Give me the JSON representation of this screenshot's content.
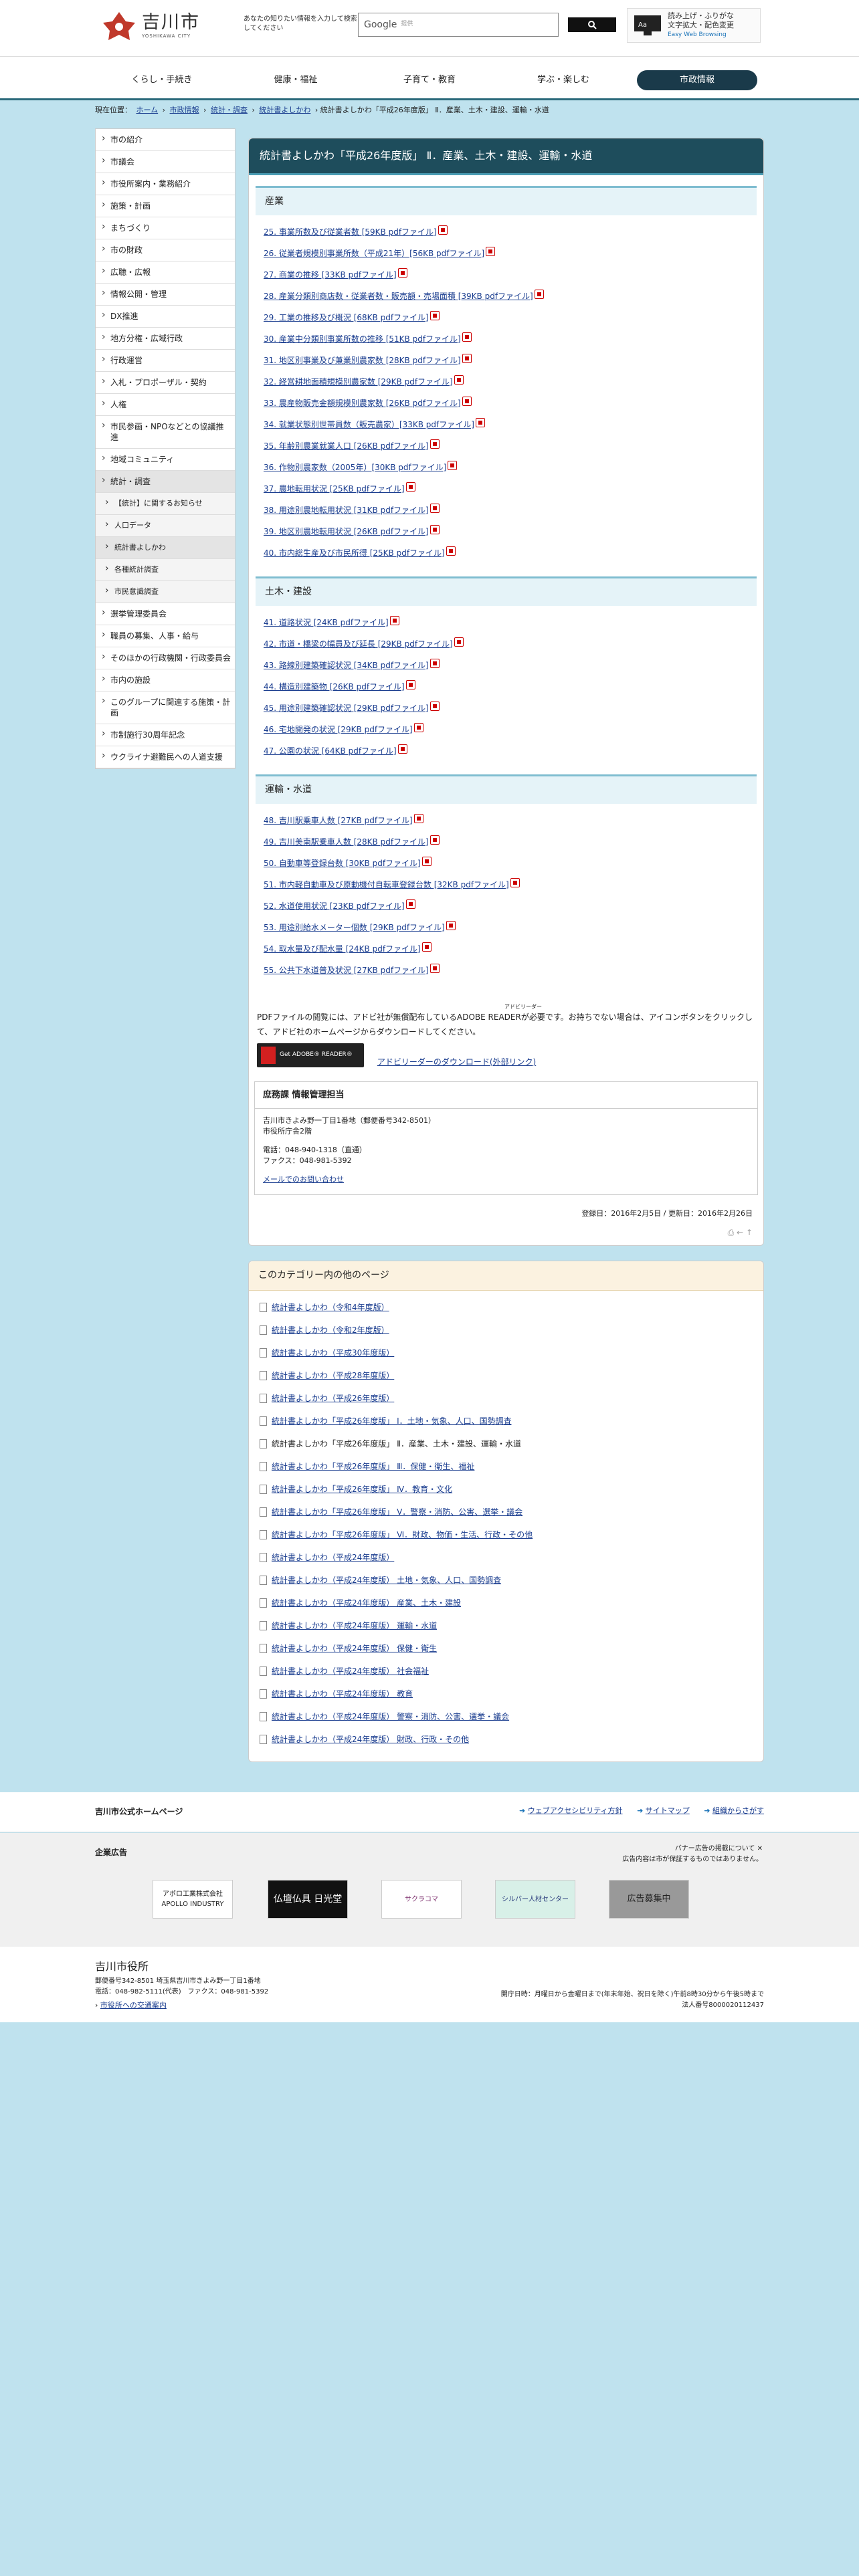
{
  "header": {
    "city_jp": "吉川市",
    "city_en": "YOSHIKAWA CITY",
    "search_note": "あなたの知りたい情報を入力して検索してください",
    "search_brand": "Google",
    "search_placeholder": "提供",
    "access_jp": "読み上げ・ふりがな\n文字拡大・配色変更",
    "access_en": "Easy Web Browsing"
  },
  "gnav": [
    "くらし・手続き",
    "健康・福祉",
    "子育て・教育",
    "学ぶ・楽しむ",
    "市政情報"
  ],
  "breadcrumb": {
    "prefix": "現在位置：",
    "links": [
      "ホーム",
      "市政情報",
      "統計・調査",
      "統計書よしかわ"
    ],
    "current": "統計書よしかわ「平成26年度版」 Ⅱ．産業、土木・建設、運輸・水道"
  },
  "sidebar": [
    "市の紹介",
    "市議会",
    "市役所案内・業務紹介",
    "施策・計画",
    "まちづくり",
    "市の財政",
    "広聴・広報",
    "情報公開・管理",
    "DX推進",
    "地方分権・広域行政",
    "行政運営",
    "入札・プロポーザル・契約",
    "人権",
    "市民参画・NPOなどとの協議推進",
    "地域コミュニティ",
    "統計・調査",
    "【統計】に関するお知らせ",
    "人口データ",
    "統計書よしかわ",
    "各種統計調査",
    "市民意識調査",
    "選挙管理委員会",
    "職員の募集、人事・給与",
    "そのほかの行政機関・行政委員会",
    "市内の施設",
    "このグループに関連する施策・計画",
    "市制施行30周年記念",
    "ウクライナ避難民への人道支援"
  ],
  "page": {
    "title": "統計書よしかわ「平成26年度版」 Ⅱ．産業、土木・建設、運輸・水道",
    "sections": [
      {
        "heading": "産業",
        "files": [
          "25. 事業所数及び従業者数 [59KB pdfファイル]",
          "26. 従業者規模別事業所数（平成21年）[56KB pdfファイル]",
          "27. 商業の推移 [33KB pdfファイル]",
          "28. 産業分類別商店数・従業者数・販売額・売場面積 [39KB pdfファイル]",
          "29. 工業の推移及び概況 [68KB pdfファイル]",
          "30. 産業中分類別事業所数の推移 [51KB pdfファイル]",
          "31. 地区別事業及び兼業別農家数 [28KB pdfファイル]",
          "32. 経営耕地面積規模別農家数 [29KB pdfファイル]",
          "33. 農産物販売金額規模別農家数 [26KB pdfファイル]",
          "34. 就業状態別世帯員数（販売農家）[33KB pdfファイル]",
          "35. 年齢別農業就業人口 [26KB pdfファイル]",
          "36. 作物別農家数（2005年）[30KB pdfファイル]",
          "37. 農地転用状況 [25KB pdfファイル]",
          "38. 用途別農地転用状況 [31KB pdfファイル]",
          "39. 地区別農地転用状況 [26KB pdfファイル]",
          "40. 市内総生産及び市民所得 [25KB pdfファイル]"
        ]
      },
      {
        "heading": "土木・建設",
        "files": [
          "41. 道路状況 [24KB pdfファイル]",
          "42. 市道・橋梁の幅員及び延長 [29KB pdfファイル]",
          "43. 路線別建築確認状況 [34KB pdfファイル]",
          "44. 構造別建築物 [26KB pdfファイル]",
          "45. 用途別建築確認状況 [29KB pdfファイル]",
          "46. 宅地開発の状況 [29KB pdfファイル]",
          "47. 公園の状況 [64KB pdfファイル]"
        ]
      },
      {
        "heading": "運輸・水道",
        "files": [
          "48. 吉川駅乗車人数 [27KB pdfファイル]",
          "49. 吉川美南駅乗車人数 [28KB pdfファイル]",
          "50. 自動車等登録台数 [30KB pdfファイル]",
          "51. 市内軽自動車及び原動機付自転車登録台数 [32KB pdfファイル]",
          "52. 水道使用状況 [23KB pdfファイル]",
          "53. 用途別給水メーター個数 [29KB pdfファイル]",
          "54. 取水量及び配水量 [24KB pdfファイル]",
          "55. 公共下水道普及状況 [27KB pdfファイル]"
        ]
      }
    ],
    "pdf_note": "PDFファイルの閲覧には、アドビ社が無償配布しているADOBE READERが必要です。お持ちでない場合は、アイコンボタンをクリックして、アドビ社のホームページからダウンロードしてください。",
    "ruby": "アドビリーダー",
    "adobe_btn": "Get ADOBE® READER®",
    "adobe_link": "アドビリーダーのダウンロード(外部リンク)",
    "contact": {
      "title": "庶務課 情報管理担当",
      "addr1": "吉川市きよみ野一丁目1番地（郵便番号342-8501）",
      "addr2": "市役所庁舎2階",
      "tel": "電話：048-940-1318（直通）",
      "fax": "ファクス：048-981-5392",
      "mail": "メールでのお問い合わせ"
    },
    "dates": "登録日：2016年2月5日 / 更新日：2016年2月26日"
  },
  "other": {
    "heading": "このカテゴリー内の他のページ",
    "items": [
      "統計書よしかわ（令和4年度版）",
      "統計書よしかわ（令和2年度版）",
      "統計書よしかわ（平成30年度版）",
      "統計書よしかわ（平成28年度版）",
      "統計書よしかわ（平成26年度版）",
      "統計書よしかわ「平成26年度版」 Ⅰ．土地・気象、人口、国勢調査",
      "統計書よしかわ「平成26年度版」 Ⅱ．産業、土木・建設、運輸・水道",
      "統計書よしかわ「平成26年度版」 Ⅲ．保健・衛生、福祉",
      "統計書よしかわ「平成26年度版」 Ⅳ．教育・文化",
      "統計書よしかわ「平成26年度版」 Ⅴ．警察・消防、公害、選挙・議会",
      "統計書よしかわ「平成26年度版」 Ⅵ．財政、物価・生活、行政・その他",
      "統計書よしかわ（平成24年度版）",
      "統計書よしかわ（平成24年度版） 土地・気象、人口、国勢調査",
      "統計書よしかわ（平成24年度版） 産業、土木・建設",
      "統計書よしかわ（平成24年度版） 運輸・水道",
      "統計書よしかわ（平成24年度版） 保健・衛生",
      "統計書よしかわ（平成24年度版） 社会福祉",
      "統計書よしかわ（平成24年度版） 教育",
      "統計書よしかわ（平成24年度版） 警察・消防、公害、選挙・議会",
      "統計書よしかわ（平成24年度版） 財政、行政・その他"
    ]
  },
  "footer_links": {
    "title": "吉川市公式ホームページ",
    "links": [
      "ウェブアクセシビリティ方針",
      "サイトマップ",
      "組織からさがす"
    ]
  },
  "ads": {
    "title": "企業広告",
    "note1": "バナー広告の掲載について",
    "note2": "広告内容は市が保証するものではありません。",
    "banners": [
      "アポロ工業株式会社\nAPOLLO INDUSTRY",
      "仏壇仏具 日光堂",
      "サクラコマ",
      "シルバー人材センター",
      "広告募集中"
    ]
  },
  "footer": {
    "name": "吉川市役所",
    "addr": "郵便番号342-8501 埼玉県吉川市きよみ野一丁目1番地",
    "tel": "電話：048-982-5111(代表)　ファクス：048-981-5392",
    "access": "市役所への交通案内",
    "hours": "開庁日時：月曜日から金曜日まで(年末年始、祝日を除く)午前8時30分から午後5時まで",
    "corp": "法人番号8000020112437"
  },
  "colors": {
    "accent": "#1e4d5c",
    "bg": "#bfe2ee"
  }
}
